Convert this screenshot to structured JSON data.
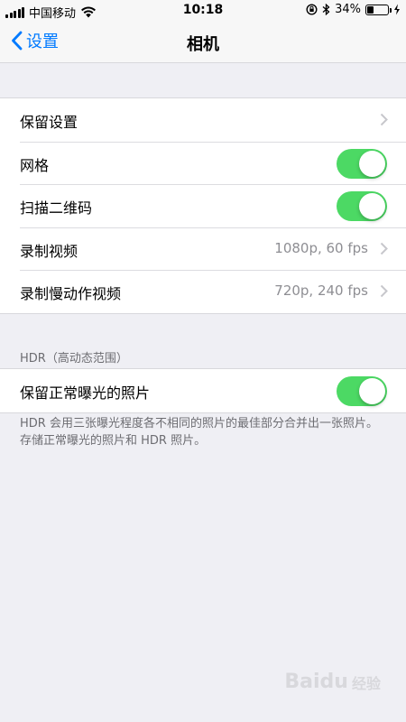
{
  "status_bar": {
    "carrier": "中国移动",
    "time": "10:18",
    "battery_text": "34%",
    "battery_level": 0.34
  },
  "nav": {
    "back_label": "设置",
    "title": "相机"
  },
  "group1": {
    "rows": [
      {
        "label": "保留设置",
        "kind": "chevron"
      },
      {
        "label": "网格",
        "kind": "toggle",
        "on": true
      },
      {
        "label": "扫描二维码",
        "kind": "toggle",
        "on": true
      },
      {
        "label": "录制视频",
        "kind": "value",
        "value": "1080p, 60 fps"
      },
      {
        "label": "录制慢动作视频",
        "kind": "value",
        "value": "720p, 240 fps"
      }
    ]
  },
  "hdr": {
    "header": "HDR（高动态范围）",
    "rows": [
      {
        "label": "保留正常曝光的照片",
        "kind": "toggle",
        "on": true
      }
    ],
    "footer_line1": "HDR 会用三张曝光程度各不相同的照片的最佳部分合并出一张照片。",
    "footer_line2": "存储正常曝光的照片和 HDR 照片。"
  },
  "watermark": {
    "text": "Baidu",
    "sub": "经验"
  },
  "colors": {
    "accent": "#007aff",
    "toggle_on": "#4cd964",
    "background": "#efeff4"
  }
}
